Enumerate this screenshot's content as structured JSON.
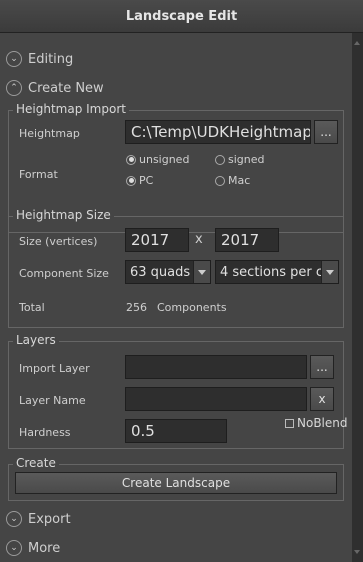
{
  "window": {
    "title": "Landscape Edit"
  },
  "sections": {
    "editing": "Editing",
    "create_new": "Create New",
    "export": "Export",
    "more": "More"
  },
  "heightmap_import": {
    "title": "Heightmap Import",
    "heightmap_label": "Heightmap",
    "heightmap_value": "C:\\Temp\\UDKHeightmap",
    "browse_label": "...",
    "format_label": "Format",
    "radio_unsigned": "unsigned",
    "radio_signed": "signed",
    "radio_pc": "PC",
    "radio_mac": "Mac"
  },
  "heightmap_size": {
    "title": "Heightmap Size",
    "size_label": "Size (vertices)",
    "size_x": "2017",
    "size_sep": "x",
    "size_y": "2017",
    "component_size_label": "Component Size",
    "component_size_value": "63 quads",
    "sections_value": "4 sections per c",
    "total_label": "Total",
    "total_value": "256",
    "total_unit": "Components"
  },
  "layers": {
    "title": "Layers",
    "import_layer_label": "Import Layer",
    "import_layer_value": "",
    "browse_label": "...",
    "layer_name_label": "Layer Name",
    "layer_name_value": "",
    "clear_label": "x",
    "hardness_label": "Hardness",
    "hardness_value": "0.5",
    "noblend_label": "NoBlend"
  },
  "create": {
    "title": "Create",
    "button_label": "Create Landscape"
  }
}
